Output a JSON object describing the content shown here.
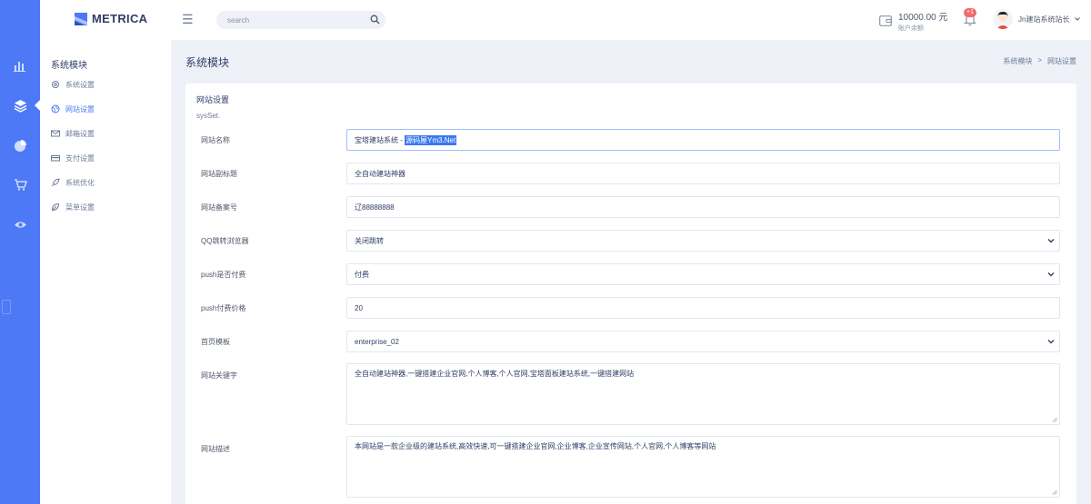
{
  "brand": {
    "name": "METRICA"
  },
  "header": {
    "search_placeholder": "search",
    "wallet_amount": "10000.00 元",
    "wallet_label": "账户余额",
    "notification_badge": "+1",
    "user_name": "Jn建站系统站长"
  },
  "rail_icons": [
    "bar-chart-icon",
    "layers-icon",
    "pie-chart-icon",
    "cart-icon",
    "eye-icon"
  ],
  "subnav": {
    "title": "系统模块",
    "items": [
      {
        "label": "系统设置",
        "icon": "gear-icon"
      },
      {
        "label": "网站设置",
        "icon": "globe-icon",
        "active": true
      },
      {
        "label": "邮箱设置",
        "icon": "mail-icon"
      },
      {
        "label": "支付设置",
        "icon": "credit-card-icon"
      },
      {
        "label": "系统优化",
        "icon": "rocket-icon"
      },
      {
        "label": "菜单设置",
        "icon": "leaf-icon"
      }
    ]
  },
  "page": {
    "title": "系统模块",
    "breadcrumb": [
      "系统模块",
      "网站设置"
    ],
    "breadcrumb_separator": ">"
  },
  "card": {
    "title": "网站设置",
    "subtitle": "sysSet.",
    "fields": [
      {
        "label": "网站名称",
        "value_prefix": "宝塔建站系统 - ",
        "value_selected": "源码屋Ym3.Net"
      },
      {
        "label": "网站副标题",
        "value": "全自动建站神器"
      },
      {
        "label": "网站备案号",
        "value": "辽88888888"
      },
      {
        "label": "QQ跳转浏览器",
        "value": "关闭跳转"
      },
      {
        "label": "push是否付费",
        "value": "付费"
      },
      {
        "label": "push付费价格",
        "value": "20"
      },
      {
        "label": "首页模板",
        "value": "enterprise_02"
      },
      {
        "label": "网站关键字",
        "value": "全自动建站神器,一键搭建企业官网,个人博客,个人官网,宝塔面板建站系统,一键搭建网站"
      },
      {
        "label": "网站描述",
        "value": "本网站是一款企业级的建站系统,高效快速,可一键搭建企业官网,企业博客,企业宣传网站,个人官网,个人博客等网站"
      }
    ]
  },
  "colors": {
    "rail": "#4d79f6",
    "active": "#4d79f6",
    "badge": "#f16a6a",
    "selection": "#3b78ef"
  }
}
